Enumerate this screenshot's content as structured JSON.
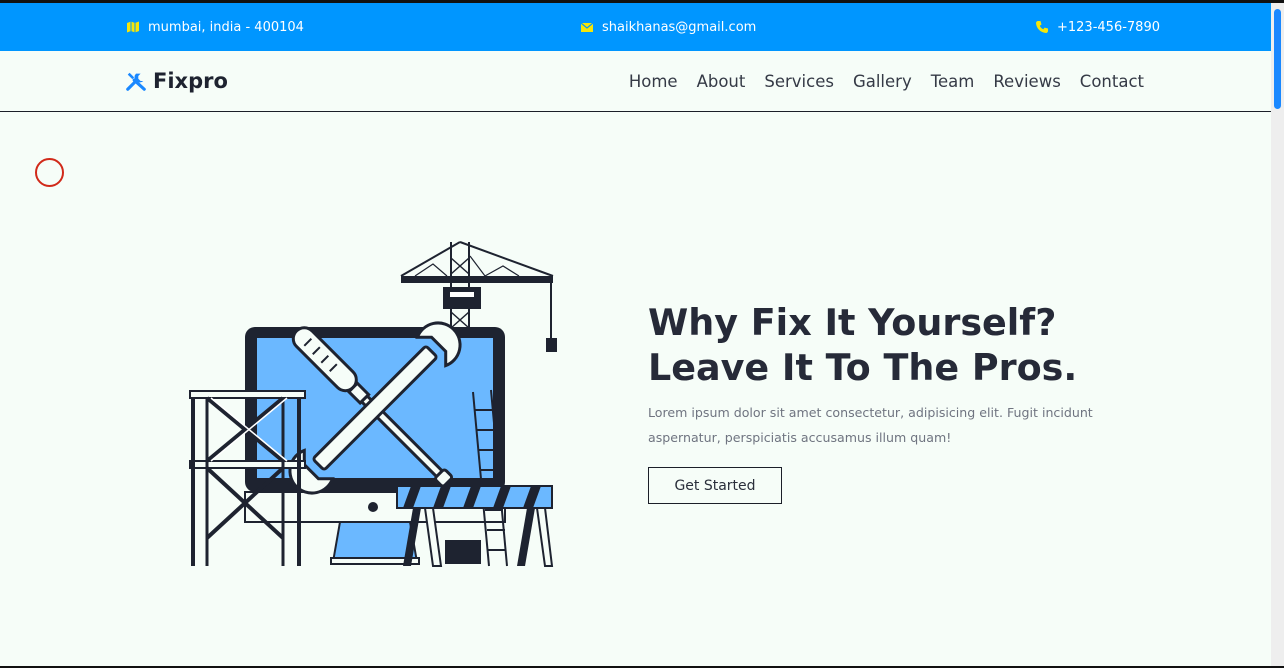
{
  "topbar": {
    "location": {
      "icon": "map-icon",
      "text": "mumbai, india - 400104"
    },
    "email": {
      "icon": "envelope-icon",
      "text": "shaikhanas@gmail.com"
    },
    "phone": {
      "icon": "phone-icon",
      "text": "+123-456-7890"
    }
  },
  "navbar": {
    "logo": {
      "icon": "tools-icon",
      "text": "Fixpro"
    },
    "links": [
      "Home",
      "About",
      "Services",
      "Gallery",
      "Team",
      "Reviews",
      "Contact"
    ]
  },
  "hero": {
    "title_line1": "Why Fix It Yourself?",
    "title_line2": "Leave It To The Pros.",
    "description": "Lorem ipsum dolor sit amet consectetur, adipisicing elit. Fugit incidunt aspernatur, perspiciatis accusamus illum quam!",
    "cta_label": "Get Started",
    "illustration": "repair-illustration"
  },
  "colors": {
    "topbar_bg": "#0096ff",
    "icon_yellow": "#f5e60a",
    "accent_blue": "#6bb8ff",
    "dark": "#1e2330",
    "page_bg": "#f6fdf8"
  }
}
